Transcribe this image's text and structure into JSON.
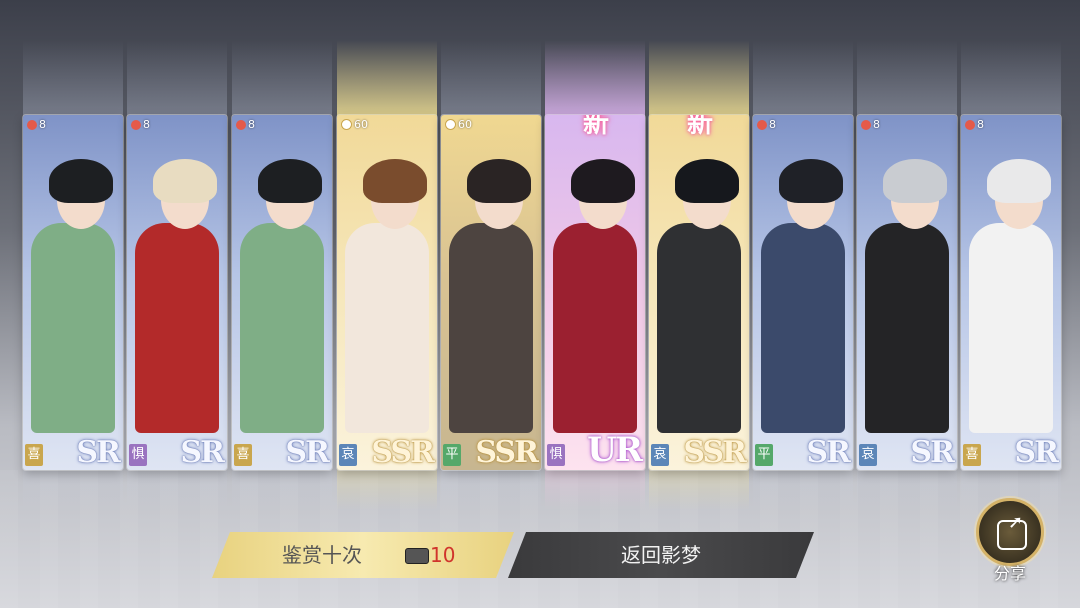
{
  "cards": [
    {
      "cost": "8",
      "cost_type": "heart",
      "new_label": "",
      "mood": "喜",
      "mood_color": "#c9a64e",
      "rarity": "SR",
      "hair": "#1d1f22",
      "body": "#7fae86"
    },
    {
      "cost": "8",
      "cost_type": "heart",
      "new_label": "",
      "mood": "惧",
      "mood_color": "#9a73c0",
      "rarity": "SR",
      "hair": "#e8dcc1",
      "body": "#b32a2a"
    },
    {
      "cost": "8",
      "cost_type": "heart",
      "new_label": "",
      "mood": "喜",
      "mood_color": "#c9a64e",
      "rarity": "SR",
      "hair": "#1d1f22",
      "body": "#7fae86"
    },
    {
      "cost": "60",
      "cost_type": "star",
      "new_label": "",
      "mood": "哀",
      "mood_color": "#5c86b8",
      "rarity": "SSR",
      "hair": "#7a4c2d",
      "body": "#f2e7dc"
    },
    {
      "cost": "60",
      "cost_type": "star",
      "new_label": "",
      "mood": "平",
      "mood_color": "#55a86a",
      "rarity": "SSR",
      "hair": "#2a2424",
      "body": "#4d4440"
    },
    {
      "cost": "",
      "cost_type": "",
      "new_label": "新",
      "mood": "惧",
      "mood_color": "#9a73c0",
      "rarity": "UR",
      "hair": "#1e1a1f",
      "body": "#9b2030"
    },
    {
      "cost": "",
      "cost_type": "",
      "new_label": "新",
      "mood": "哀",
      "mood_color": "#5c86b8",
      "rarity": "SSR",
      "hair": "#16181d",
      "body": "#2f3033"
    },
    {
      "cost": "8",
      "cost_type": "heart",
      "new_label": "",
      "mood": "平",
      "mood_color": "#55a86a",
      "rarity": "SR",
      "hair": "#1f2127",
      "body": "#3b4a6b"
    },
    {
      "cost": "8",
      "cost_type": "heart",
      "new_label": "",
      "mood": "哀",
      "mood_color": "#5c86b8",
      "rarity": "SR",
      "hair": "#c9ccd1",
      "body": "#242426"
    },
    {
      "cost": "8",
      "cost_type": "heart",
      "new_label": "",
      "mood": "喜",
      "mood_color": "#c9a64e",
      "rarity": "SR",
      "hair": "#e9e9ea",
      "body": "#f2f2f2"
    }
  ],
  "buttons": {
    "appraise_label": "鉴赏十次",
    "appraise_cost": "10",
    "return_label": "返回影梦",
    "share_label": "分享"
  }
}
